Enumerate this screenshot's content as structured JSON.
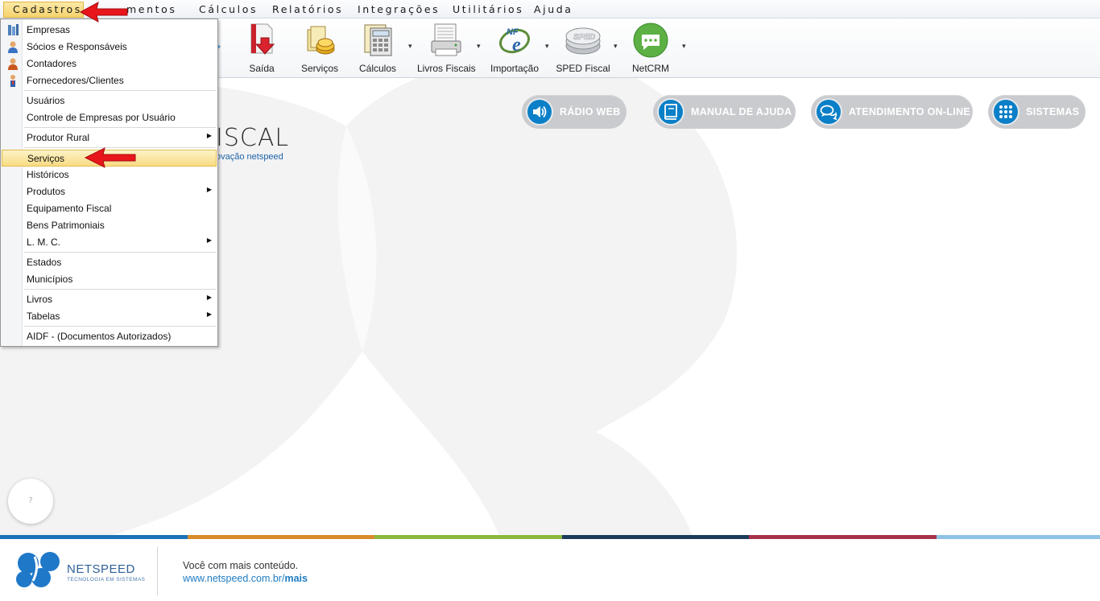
{
  "menubar": {
    "items": [
      {
        "label": "Cadastros",
        "active": true
      },
      {
        "label": "Lançamentos",
        "visible_part": "mentos"
      },
      {
        "label": "Cálculos"
      },
      {
        "label": "Relatórios"
      },
      {
        "label": "Integrações"
      },
      {
        "label": "Utilitários"
      },
      {
        "label": "Ajuda"
      }
    ]
  },
  "toolbar": {
    "items": [
      {
        "label": "Saída",
        "icon": "saida-icon"
      },
      {
        "label": "Serviços",
        "icon": "servicos-icon"
      },
      {
        "label": "Cálculos",
        "icon": "calculos-icon"
      },
      {
        "label": "Livros Fiscais",
        "icon": "livros-fiscais-icon"
      },
      {
        "label": "Importação",
        "icon": "nfe-icon"
      },
      {
        "label": "SPED Fiscal",
        "icon": "sped-icon"
      },
      {
        "label": "NetCRM",
        "icon": "netcrm-icon"
      }
    ],
    "dropdown_arrow": "▾"
  },
  "main": {
    "buttons": [
      {
        "label": "RÁDIO WEB",
        "icon": "speaker-icon"
      },
      {
        "label": "MANUAL DE AJUDA",
        "icon": "book-icon"
      },
      {
        "label": "ATENDIMENTO ON-LINE",
        "icon": "chat-icon"
      },
      {
        "label": "SISTEMAS",
        "icon": "grid-icon"
      }
    ],
    "brand_partial": "ISCAL",
    "brand_sub_partial": "ovação netspeed",
    "help_label": "?"
  },
  "dropdown": {
    "items": [
      {
        "label": "Empresas",
        "icon": "empresas-icon"
      },
      {
        "label": "Sócios e Responsáveis",
        "icon": "socios-icon"
      },
      {
        "label": "Contadores",
        "icon": "contadores-icon"
      },
      {
        "label": "Fornecedores/Clientes",
        "icon": "fornecedores-icon"
      },
      {
        "label": "Usuários"
      },
      {
        "label": "Controle de Empresas por Usuário"
      },
      {
        "label": "Produtor Rural",
        "submenu": true
      },
      {
        "label": "Serviços",
        "highlighted": true
      },
      {
        "label": "Históricos"
      },
      {
        "label": "Produtos",
        "submenu": true
      },
      {
        "label": "Equipamento Fiscal"
      },
      {
        "label": "Bens Patrimoniais"
      },
      {
        "label": "L. M. C.",
        "submenu": true
      },
      {
        "label": "Estados"
      },
      {
        "label": "Municípios"
      },
      {
        "label": "Livros",
        "submenu": true
      },
      {
        "label": "Tabelas",
        "submenu": true
      },
      {
        "label": "AIDF - (Documentos Autorizados)"
      }
    ],
    "submenu_glyph": "▶"
  },
  "footer": {
    "brand": "NETSPEED",
    "tagline": "TECNOLOGIA EM SISTEMAS",
    "line1": "Você com mais conteúdo.",
    "line2_prefix": "www.netspeed.com.br/",
    "line2_bold": "mais"
  },
  "colors": {
    "accent_blue": "#0b7fc7",
    "menu_highlight": "#f8dc83",
    "stripe": [
      "#1a73b8",
      "#d98b2b",
      "#8cb83d",
      "#1d3b5c",
      "#a6334a",
      "#8ec3e6"
    ]
  }
}
